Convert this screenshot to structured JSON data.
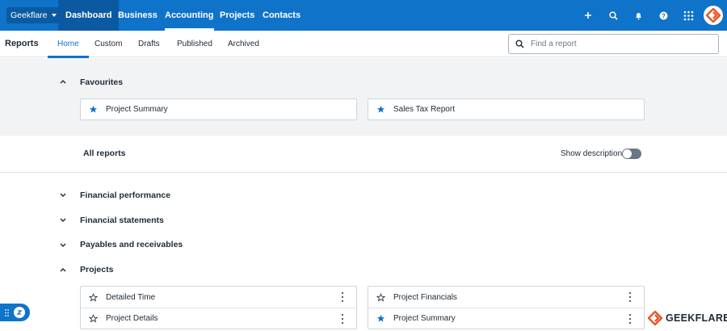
{
  "topbar": {
    "org_label": "Geekflare",
    "nav": [
      "Dashboard",
      "Business",
      "Accounting",
      "Projects",
      "Contacts"
    ],
    "icons": [
      "plus-icon",
      "search-icon",
      "bell-icon",
      "help-icon",
      "apps-grid-icon"
    ],
    "colors": {
      "bar": "#0f73c9",
      "active": "#0b5aa1"
    }
  },
  "subnav": {
    "title": "Reports",
    "tabs": [
      "Home",
      "Custom",
      "Drafts",
      "Published",
      "Archived"
    ],
    "active_tab": "Home",
    "search_placeholder": "Find a report"
  },
  "favourites": {
    "heading": "Favourites",
    "items": [
      "Project Summary",
      "Sales Tax Report"
    ]
  },
  "all_reports": {
    "heading": "All reports",
    "show_descriptions_label": "Show descriptions",
    "show_descriptions_on": false
  },
  "categories": [
    {
      "label": "Financial performance",
      "expanded": false
    },
    {
      "label": "Financial statements",
      "expanded": false
    },
    {
      "label": "Payables and receivables",
      "expanded": false
    },
    {
      "label": "Projects",
      "expanded": true
    }
  ],
  "projects": {
    "left": [
      {
        "label": "Detailed Time",
        "starred": false
      },
      {
        "label": "Project Details",
        "starred": false
      }
    ],
    "right": [
      {
        "label": "Project Financials",
        "starred": false
      },
      {
        "label": "Project Summary",
        "starred": true
      }
    ]
  },
  "watermark": {
    "text": "GEEKFLARE",
    "color": "#e8562a"
  }
}
